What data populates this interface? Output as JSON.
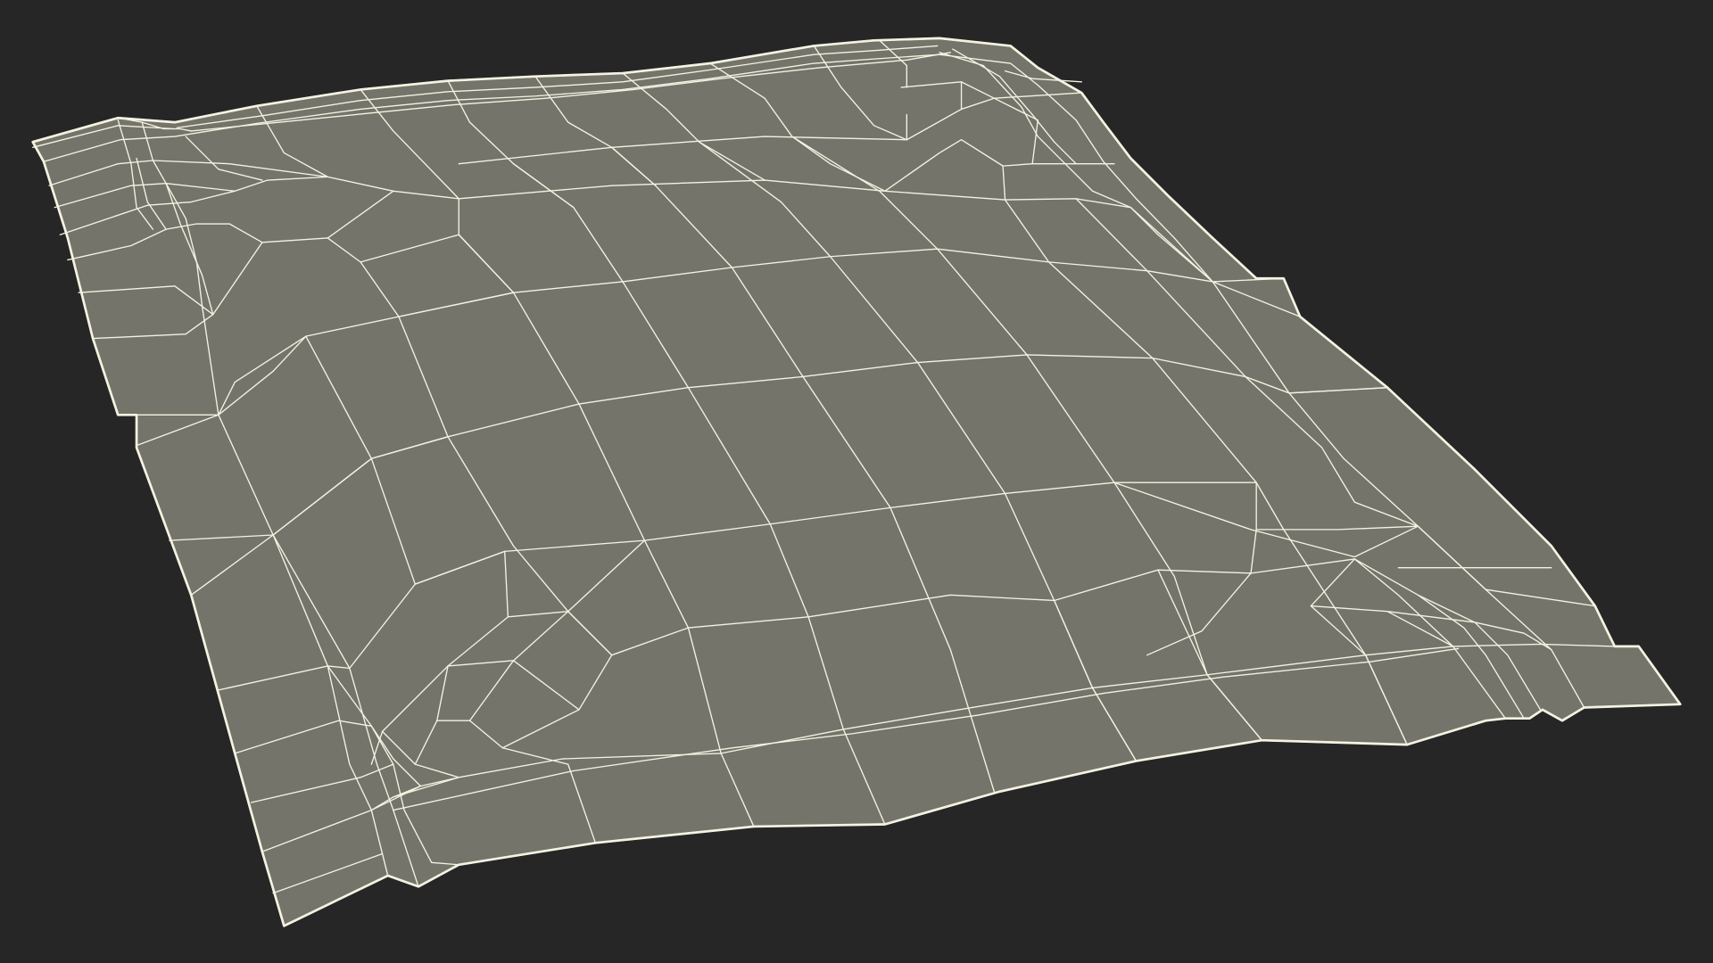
{
  "scene": {
    "subject": "wireframe-cloth-mesh",
    "background_color": "#262626",
    "surface_color": "#74746a",
    "wire_color": "#f4f3e2"
  }
}
